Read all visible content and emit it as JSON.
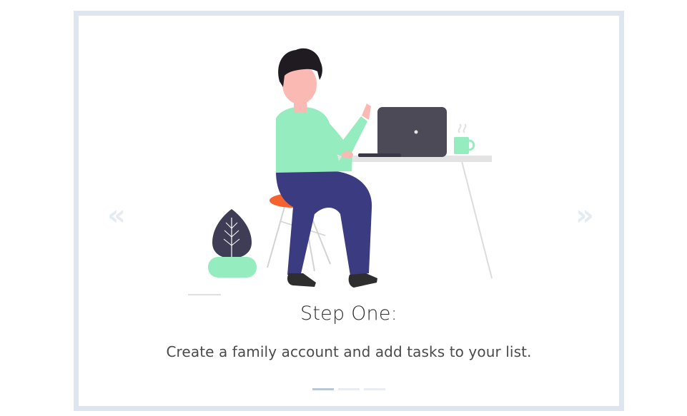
{
  "carousel": {
    "prev_label": "«",
    "next_label": "»",
    "slide": {
      "title": "Step One:",
      "description": "Create a family account and add tasks to your list."
    },
    "dots": [
      {
        "active": true
      },
      {
        "active": false
      },
      {
        "active": false
      }
    ]
  },
  "colors": {
    "card_border": "#dde5ef",
    "shirt": "#95ecbe",
    "pants": "#3b3b82",
    "skin": "#fbb9b3",
    "hair": "#1f1b21",
    "laptop": "#4c4a56",
    "seat": "#f4632f",
    "leaf": "#3f3d56",
    "arrow": "#e6ebf2",
    "dot_active": "#b9c8d6",
    "dot_inactive": "#e9edf2"
  }
}
